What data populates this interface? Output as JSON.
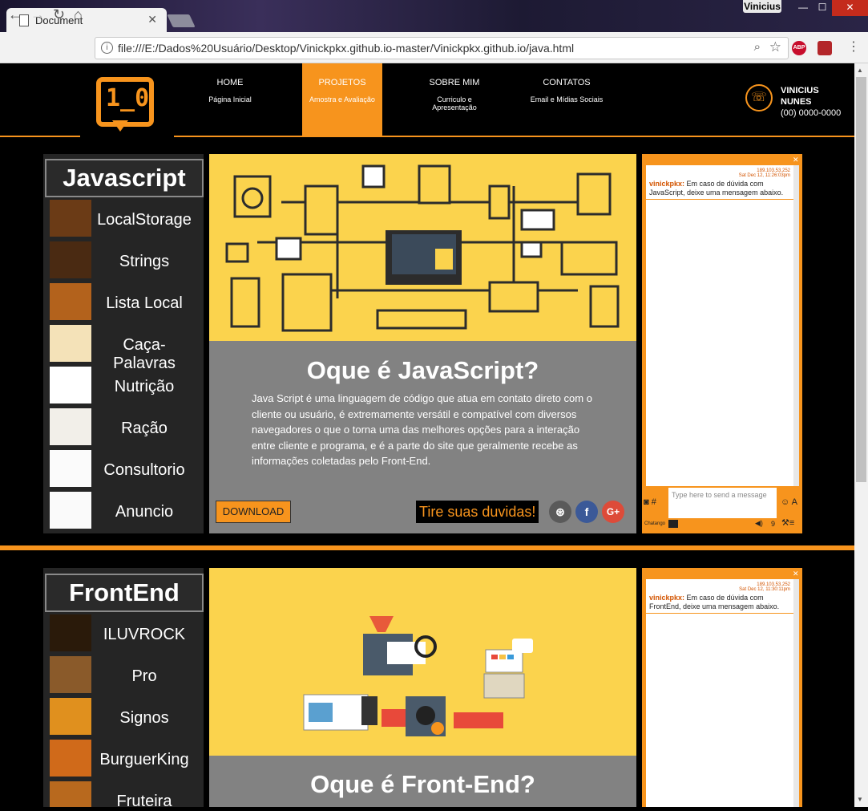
{
  "browser": {
    "tab_title": "Document",
    "tab_close": "✕",
    "user_badge": "Vinicius",
    "url": "file:///E:/Dados%20Usuário/Desktop/Vinickpkx.github.io-master/Vinickpkx.github.io/java.html",
    "abp_label": "ABP"
  },
  "header": {
    "logo_text": "1_0",
    "menu": [
      {
        "label": "HOME",
        "sub": "Página Inicial"
      },
      {
        "label": "PROJETOS",
        "sub": "Amostra e Avaliação"
      },
      {
        "label": "SOBRE MIM",
        "sub": "Curriculo e Apresentação"
      },
      {
        "label": "CONTATOS",
        "sub": "Email e Mídias Sociais"
      }
    ],
    "contact": {
      "name_line1": "VINICIUS",
      "name_line2": "NUNES",
      "phone": "(00) 0000-0000"
    }
  },
  "sections": [
    {
      "title": "Javascript",
      "items": [
        "LocalStorage",
        "Strings",
        "Lista Local",
        "Caça-Palavras",
        "Nutrição",
        "Ração",
        "Consultorio",
        "Anuncio"
      ],
      "heading": "Oque é JavaScript?",
      "description": "Java Script é uma linguagem de código que atua em contato direto com o cliente ou usuário, é extremamente versátil e compatível com diversos navegadores o que o torna uma das melhores opções para a interação entre cliente e programa, e é a parte do site que geralmente recebe as informações coletadas pelo Front-End.",
      "download": "DOWNLOAD",
      "duvidas": "Tire suas duvidas!",
      "chat": {
        "ip": "189.103.53.252",
        "time": "Sat Dec 12, 11:26:03pm",
        "user": "vinickpkx:",
        "message": "Em caso de dúvida com JavaScript, deixe uma mensagem abaixo.",
        "placeholder": "Type here to send a message",
        "footer_label": "Chatango",
        "count": "9"
      }
    },
    {
      "title": "FrontEnd",
      "items": [
        "ILUVROCK",
        "Pro",
        "Signos",
        "BurguerKing",
        "Fruteira"
      ],
      "heading": "Oque é Front-End?",
      "chat": {
        "ip": "189.103.53.252",
        "time": "Sat Dec 12, 11:30:11pm",
        "user": "vinickpkx:",
        "message": "Em caso de dúvida com FrontEnd, deixe uma mensagem abaixo."
      }
    }
  ],
  "colors": {
    "accent": "#f7941d",
    "panel_yellow": "#fbd34d",
    "grey": "#828282"
  }
}
